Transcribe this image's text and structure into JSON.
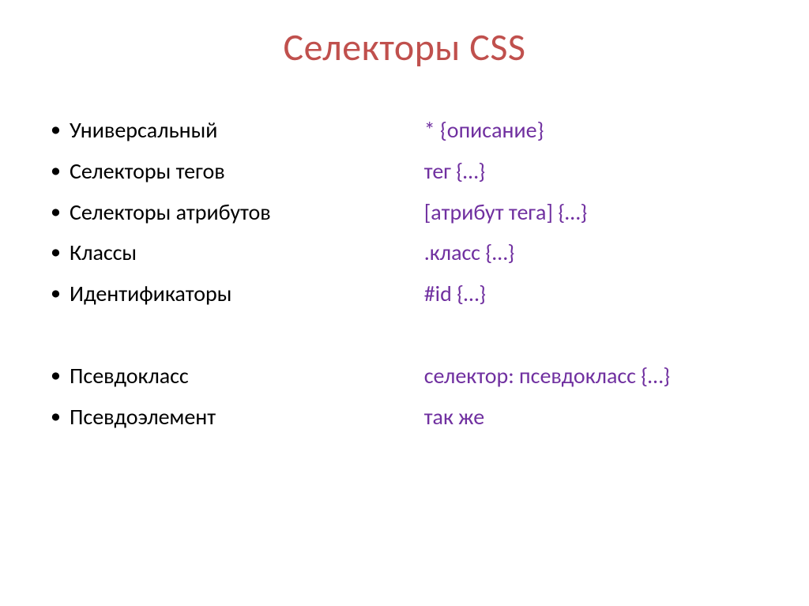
{
  "title": "Селекторы CSS",
  "left": {
    "items": [
      "Универсальный",
      "Селекторы тегов",
      "Селекторы атрибутов",
      "Классы",
      "Идентификаторы"
    ],
    "items2": [
      "Псевдокласс",
      "Псевдоэлемент"
    ]
  },
  "right": {
    "lines": [
      "* {описание}",
      "тег {…}",
      "[атрибут тега] {…}",
      ".класс {…}",
      "#id {…}"
    ],
    "lines2": [
      "селектор: псевдокласс {…}",
      "так же"
    ]
  }
}
